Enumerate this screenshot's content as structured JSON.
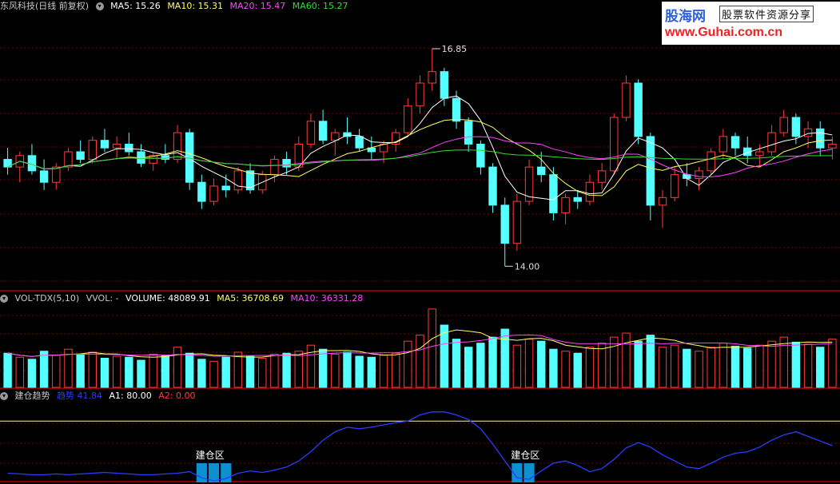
{
  "panels": {
    "price": {
      "header": {
        "title": "东风科技(日线 前复权)",
        "ma5": "MA5: 15.26",
        "ma10": "MA10: 15.31",
        "ma20": "MA20: 15.47",
        "ma60": "MA60: 15.27"
      },
      "annotations": {
        "high": "16.85",
        "low": "14.00"
      }
    },
    "volume": {
      "header": {
        "title": "VOL-TDX(5,10)",
        "vvol": "VVOL: -",
        "volume": "VOLUME: 48089.91",
        "ma5": "MA5: 36708.69",
        "ma10": "MA10: 36331.28"
      }
    },
    "indicator": {
      "header": {
        "title": "建仓趋势",
        "line": "趋势 41.84",
        "a1": "A1: 80.00",
        "a2": "A2: 0.00"
      },
      "zone_label": "建仓区"
    }
  },
  "watermark": {
    "name": "股海网",
    "tagline": "股票软件资源分享",
    "url": "www.Guhai.com.cn"
  },
  "colors": {
    "up": "#ff3b3b",
    "down": "#54ffff",
    "ma5": "#ffffff",
    "ma10": "#ffff66",
    "ma20": "#ff44ff",
    "ma60": "#33dd33",
    "trend": "#2a3cff",
    "zone": "#0e8fd0",
    "grid": "#7a0000"
  },
  "chart_data": [
    {
      "type": "candlestick",
      "title": "东风科技(日线 前复权)",
      "y_range": [
        13.7,
        17.3
      ],
      "annotations": [
        {
          "label": "16.85",
          "value": 16.85
        },
        {
          "label": "14.00",
          "value": 14.0
        }
      ],
      "ohlc": [
        [
          15.4,
          15.55,
          15.2,
          15.3
        ],
        [
          15.3,
          15.5,
          15.1,
          15.45
        ],
        [
          15.45,
          15.6,
          15.2,
          15.25
        ],
        [
          15.25,
          15.4,
          15.0,
          15.1
        ],
        [
          15.1,
          15.35,
          15.0,
          15.3
        ],
        [
          15.3,
          15.55,
          15.25,
          15.5
        ],
        [
          15.5,
          15.65,
          15.35,
          15.4
        ],
        [
          15.4,
          15.7,
          15.35,
          15.65
        ],
        [
          15.65,
          15.8,
          15.5,
          15.55
        ],
        [
          15.55,
          15.7,
          15.4,
          15.6
        ],
        [
          15.6,
          15.75,
          15.45,
          15.5
        ],
        [
          15.5,
          15.6,
          15.3,
          15.35
        ],
        [
          15.35,
          15.5,
          15.25,
          15.45
        ],
        [
          15.45,
          15.6,
          15.35,
          15.4
        ],
        [
          15.4,
          15.85,
          15.35,
          15.75
        ],
        [
          15.75,
          15.8,
          15.0,
          15.1
        ],
        [
          15.1,
          15.2,
          14.75,
          14.85
        ],
        [
          14.85,
          15.15,
          14.8,
          15.05
        ],
        [
          15.05,
          15.2,
          14.9,
          15.0
        ],
        [
          15.0,
          15.3,
          14.95,
          15.25
        ],
        [
          15.25,
          15.35,
          14.95,
          15.0
        ],
        [
          15.0,
          15.25,
          14.95,
          15.2
        ],
        [
          15.2,
          15.45,
          15.1,
          15.4
        ],
        [
          15.4,
          15.5,
          15.2,
          15.3
        ],
        [
          15.3,
          15.7,
          15.25,
          15.6
        ],
        [
          15.6,
          16.0,
          15.55,
          15.9
        ],
        [
          15.9,
          16.05,
          15.6,
          15.65
        ],
        [
          15.65,
          15.8,
          15.45,
          15.75
        ],
        [
          15.75,
          15.95,
          15.6,
          15.7
        ],
        [
          15.7,
          15.8,
          15.5,
          15.55
        ],
        [
          15.55,
          15.7,
          15.4,
          15.5
        ],
        [
          15.5,
          15.65,
          15.35,
          15.6
        ],
        [
          15.6,
          15.8,
          15.5,
          15.75
        ],
        [
          15.75,
          16.2,
          15.7,
          16.1
        ],
        [
          16.1,
          16.5,
          16.0,
          16.4
        ],
        [
          16.4,
          16.85,
          16.3,
          16.55
        ],
        [
          16.55,
          16.6,
          16.1,
          16.2
        ],
        [
          16.2,
          16.3,
          15.8,
          15.9
        ],
        [
          15.9,
          15.95,
          15.5,
          15.6
        ],
        [
          15.6,
          15.65,
          15.2,
          15.3
        ],
        [
          15.3,
          15.35,
          14.7,
          14.8
        ],
        [
          14.8,
          14.9,
          14.0,
          14.3
        ],
        [
          14.3,
          14.95,
          14.2,
          14.85
        ],
        [
          14.85,
          15.4,
          14.8,
          15.3
        ],
        [
          15.3,
          15.5,
          15.1,
          15.2
        ],
        [
          15.2,
          15.3,
          14.6,
          14.7
        ],
        [
          14.7,
          14.95,
          14.55,
          14.9
        ],
        [
          14.9,
          15.0,
          14.75,
          14.85
        ],
        [
          14.85,
          15.2,
          14.8,
          15.1
        ],
        [
          15.1,
          15.35,
          15.0,
          15.25
        ],
        [
          15.25,
          16.0,
          15.2,
          15.95
        ],
        [
          15.95,
          16.5,
          15.9,
          16.4
        ],
        [
          16.4,
          16.45,
          15.6,
          15.7
        ],
        [
          15.7,
          15.75,
          14.6,
          14.8
        ],
        [
          14.8,
          15.0,
          14.5,
          14.9
        ],
        [
          14.9,
          15.3,
          14.85,
          15.2
        ],
        [
          15.2,
          15.35,
          15.05,
          15.15
        ],
        [
          15.15,
          15.3,
          15.0,
          15.25
        ],
        [
          15.25,
          15.55,
          15.2,
          15.5
        ],
        [
          15.5,
          15.8,
          15.4,
          15.7
        ],
        [
          15.7,
          15.75,
          15.45,
          15.55
        ],
        [
          15.55,
          15.7,
          15.35,
          15.45
        ],
        [
          15.45,
          15.6,
          15.3,
          15.5
        ],
        [
          15.5,
          15.85,
          15.45,
          15.75
        ],
        [
          15.75,
          16.05,
          15.7,
          15.95
        ],
        [
          15.95,
          16.0,
          15.6,
          15.7
        ],
        [
          15.7,
          15.9,
          15.55,
          15.8
        ],
        [
          15.8,
          15.9,
          15.45,
          15.55
        ],
        [
          15.55,
          15.7,
          15.4,
          15.6
        ]
      ]
    },
    {
      "type": "bar",
      "title": "VOL-TDX(5,10)",
      "series": [
        {
          "name": "VOLUME",
          "last": 48089.91
        },
        {
          "name": "MA5",
          "last": 36708.69
        },
        {
          "name": "MA10",
          "last": 36331.28
        }
      ],
      "volume": [
        34,
        30,
        28,
        36,
        32,
        38,
        33,
        35,
        29,
        31,
        30,
        27,
        33,
        32,
        40,
        34,
        28,
        26,
        30,
        35,
        31,
        29,
        33,
        34,
        36,
        42,
        38,
        33,
        35,
        31,
        30,
        32,
        34,
        46,
        52,
        78,
        62,
        48,
        40,
        44,
        50,
        58,
        42,
        48,
        46,
        38,
        36,
        34,
        40,
        44,
        50,
        54,
        46,
        52,
        40,
        42,
        38,
        36,
        40,
        44,
        41,
        39,
        42,
        46,
        50,
        45,
        43,
        40,
        48
      ]
    },
    {
      "type": "line",
      "title": "建仓趋势",
      "y_range": [
        0,
        100
      ],
      "series": [
        {
          "name": "趋势",
          "last": 41.84
        },
        {
          "name": "A1",
          "last": 80.0
        },
        {
          "name": "A2",
          "last": 0.0
        }
      ],
      "trend": [
        12,
        11,
        10,
        10,
        11,
        10,
        11,
        12,
        13,
        12,
        11,
        10,
        10,
        11,
        12,
        14,
        6,
        2,
        5,
        12,
        15,
        13,
        16,
        20,
        28,
        40,
        55,
        66,
        72,
        70,
        72,
        75,
        78,
        80,
        88,
        92,
        92,
        88,
        82,
        70,
        50,
        28,
        6,
        4,
        15,
        25,
        28,
        22,
        14,
        18,
        30,
        45,
        52,
        46,
        36,
        28,
        20,
        18,
        25,
        33,
        38,
        40,
        46,
        55,
        62,
        66,
        60,
        54,
        48
      ]
    }
  ]
}
